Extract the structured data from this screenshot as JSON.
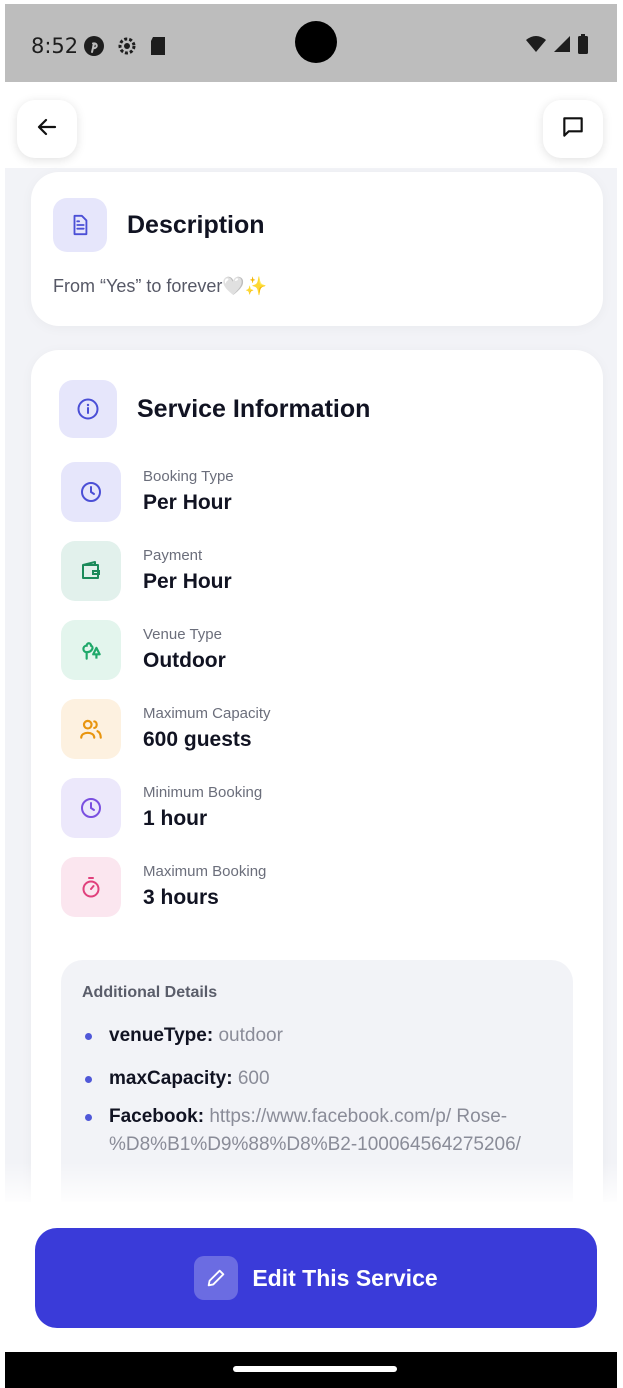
{
  "status_bar": {
    "time": "8:52",
    "left_icons": [
      "pinterest-icon",
      "settings-icon",
      "sd-card-icon"
    ],
    "right_icons": [
      "wifi-icon",
      "signal-icon",
      "battery-icon"
    ]
  },
  "app_bar": {
    "back_icon": "arrow-left-icon",
    "chat_icon": "message-square-icon"
  },
  "description": {
    "title": "Description",
    "icon": "file-text-icon",
    "text": "From “Yes” to forever🤍✨"
  },
  "service_info": {
    "title": "Service Information",
    "icon": "info-icon",
    "rows": [
      {
        "label": "Booking Type",
        "value": "Per Hour",
        "icon": "clock-icon",
        "bg": "#e6e6fb",
        "color": "#4b4fd6"
      },
      {
        "label": "Payment",
        "value": "Per Hour",
        "icon": "wallet-icon",
        "bg": "#e2f1ec",
        "color": "#1b8a5a"
      },
      {
        "label": "Venue Type",
        "value": "Outdoor",
        "icon": "trees-icon",
        "bg": "#e3f5ed",
        "color": "#1fa86a"
      },
      {
        "label": "Maximum Capacity",
        "value": "600 guests",
        "icon": "users-icon",
        "bg": "#fdf1e0",
        "color": "#e8950f"
      },
      {
        "label": "Minimum Booking",
        "value": "1 hour",
        "icon": "clock-icon",
        "bg": "#ece8fb",
        "color": "#7a4fe0"
      },
      {
        "label": "Maximum Booking",
        "value": "3 hours",
        "icon": "timer-icon",
        "bg": "#fbe6ef",
        "color": "#e0407c"
      }
    ],
    "additional": {
      "title": "Additional Details",
      "items": [
        {
          "key": "venueType:",
          "value": "outdoor"
        },
        {
          "key": "maxCapacity:",
          "value": "600"
        },
        {
          "key": "Facebook:",
          "value": "https://www.facebook.com/p/ Rose- %D8%B1%D9%88%D8%B2-100064564275206/"
        }
      ]
    }
  },
  "bottom": {
    "edit_label": "Edit This Service",
    "edit_icon": "pencil-icon"
  },
  "colors": {
    "accent": "#3a3bd9"
  }
}
